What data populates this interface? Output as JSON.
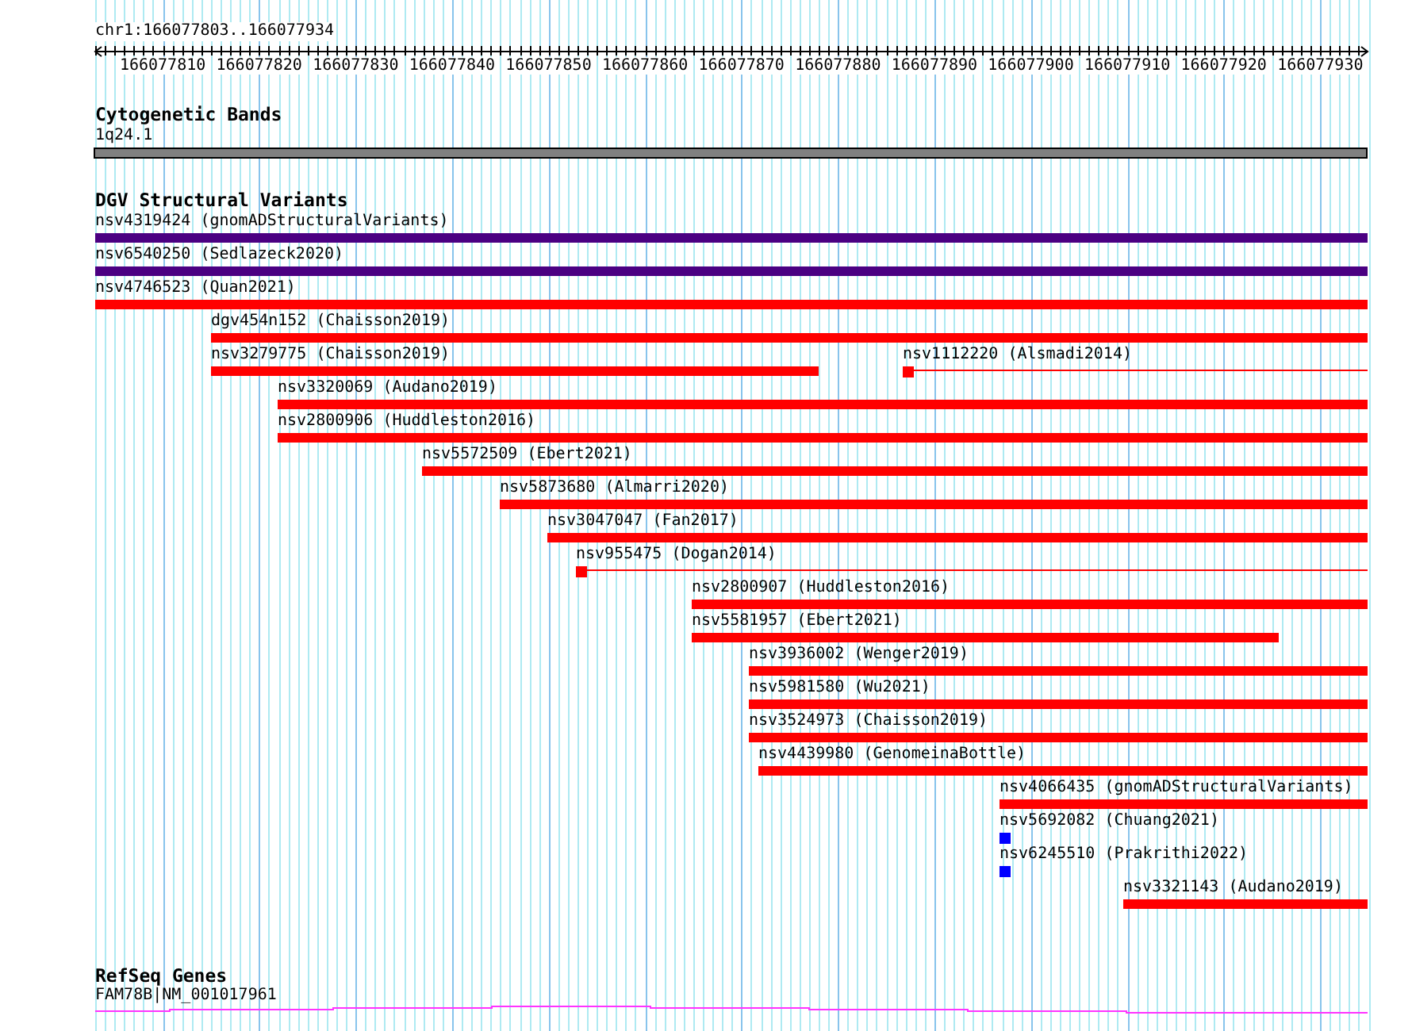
{
  "location": "chr1:166077803..166077934",
  "ruler": {
    "ticks": [
      "166077810",
      "166077820",
      "166077830",
      "166077840",
      "166077850",
      "166077860",
      "166077870",
      "166077880",
      "166077890",
      "166077900",
      "166077910",
      "166077920",
      "166077930"
    ]
  },
  "tracks": [
    {
      "kind": "cytoband",
      "title": "Cytogenetic Bands",
      "band": "1q24.1"
    },
    {
      "kind": "variants",
      "title": "DGV Structural Variants",
      "rows": [
        {
          "features": [
            {
              "label": "nsv4319424 (gnomADStructuralVariants)",
              "kind": "bar",
              "color": "#4b0082"
            }
          ]
        },
        {
          "features": [
            {
              "label": "nsv6540250 (Sedlazeck2020)",
              "kind": "bar",
              "color": "#4b0082"
            }
          ]
        },
        {
          "features": [
            {
              "label": "nsv4746523 (Quan2021)",
              "kind": "bar",
              "color": "#ff0000"
            }
          ]
        },
        {
          "features": [
            {
              "label": "dgv454n152 (Chaisson2019)",
              "kind": "bar",
              "color": "#ff0000"
            }
          ]
        },
        {
          "features": [
            {
              "label": "nsv3279775 (Chaisson2019)",
              "kind": "bar",
              "color": "#ff0000"
            },
            {
              "label": "nsv1112220 (Alsmadi2014)",
              "kind": "point-line",
              "color": "#ff0000"
            }
          ]
        },
        {
          "features": [
            {
              "label": "nsv3320069 (Audano2019)",
              "kind": "bar",
              "color": "#ff0000"
            }
          ]
        },
        {
          "features": [
            {
              "label": "nsv2800906 (Huddleston2016)",
              "kind": "bar",
              "color": "#ff0000"
            }
          ]
        },
        {
          "features": [
            {
              "label": "nsv5572509 (Ebert2021)",
              "kind": "bar",
              "color": "#ff0000"
            }
          ]
        },
        {
          "features": [
            {
              "label": "nsv5873680 (Almarri2020)",
              "kind": "bar",
              "color": "#ff0000"
            }
          ]
        },
        {
          "features": [
            {
              "label": "nsv3047047 (Fan2017)",
              "kind": "bar",
              "color": "#ff0000"
            }
          ]
        },
        {
          "features": [
            {
              "label": "nsv955475 (Dogan2014)",
              "kind": "point-line",
              "color": "#ff0000"
            }
          ]
        },
        {
          "features": [
            {
              "label": "nsv2800907 (Huddleston2016)",
              "kind": "bar",
              "color": "#ff0000"
            }
          ]
        },
        {
          "features": [
            {
              "label": "nsv5581957 (Ebert2021)",
              "kind": "bar",
              "color": "#ff0000"
            }
          ]
        },
        {
          "features": [
            {
              "label": "nsv3936002 (Wenger2019)",
              "kind": "bar",
              "color": "#ff0000"
            }
          ]
        },
        {
          "features": [
            {
              "label": "nsv5981580 (Wu2021)",
              "kind": "bar",
              "color": "#ff0000"
            }
          ]
        },
        {
          "features": [
            {
              "label": "nsv3524973 (Chaisson2019)",
              "kind": "bar",
              "color": "#ff0000"
            }
          ]
        },
        {
          "features": [
            {
              "label": "nsv4439980 (GenomeinaBottle)",
              "kind": "bar",
              "color": "#ff0000"
            }
          ]
        },
        {
          "features": [
            {
              "label": "nsv4066435 (gnomADStructuralVariants)",
              "kind": "bar",
              "color": "#ff0000"
            }
          ]
        },
        {
          "features": [
            {
              "label": "nsv5692082 (Chuang2021)",
              "kind": "point",
              "color": "#0000ff"
            }
          ]
        },
        {
          "features": [
            {
              "label": "nsv6245510 (Prakrithi2022)",
              "kind": "point",
              "color": "#0000ff"
            }
          ]
        },
        {
          "features": [
            {
              "label": "nsv3321143 (Audano2019)",
              "kind": "bar",
              "color": "#ff0000"
            }
          ]
        }
      ]
    },
    {
      "kind": "genes",
      "title": "RefSeq Genes",
      "gene": "FAM78B|NM_001017961"
    }
  ]
}
